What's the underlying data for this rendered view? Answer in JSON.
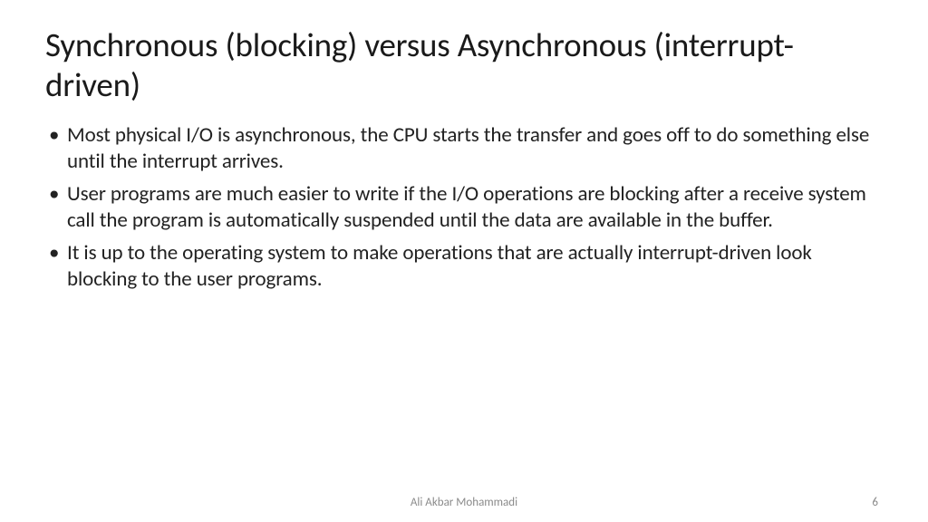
{
  "slide": {
    "title": "Synchronous (blocking) versus Asynchronous (interrupt-driven)",
    "bullets": [
      "Most physical I/O is asynchronous, the CPU starts the transfer and goes off to do something else until the interrupt arrives.",
      "User programs are much easier to write if the I/O operations are blocking after a receive system call the program is automatically suspended until the data are available in the buffer.",
      "It is up to the operating system to make operations that are actually interrupt-driven look blocking to the user programs."
    ]
  },
  "footer": {
    "author": "Ali Akbar Mohammadi",
    "page": "6"
  }
}
